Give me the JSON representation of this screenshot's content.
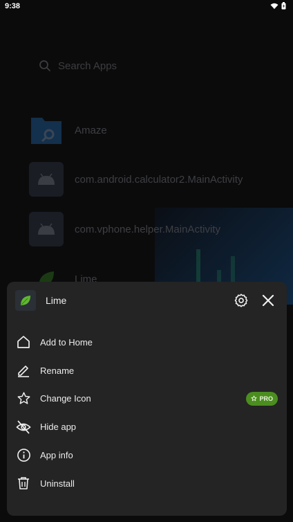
{
  "status_bar": {
    "time": "9:38"
  },
  "search": {
    "placeholder": "Search Apps"
  },
  "apps": [
    {
      "label": "Amaze",
      "icon": "folder-search-icon"
    },
    {
      "label": "com.android.calculator2.MainActivity",
      "icon": "android-icon"
    },
    {
      "label": "com.vphone.helper.MainActivity",
      "icon": "android-icon"
    },
    {
      "label": "Lime",
      "icon": "leaf-icon"
    }
  ],
  "sheet": {
    "app_name": "Lime",
    "items": [
      {
        "label": "Add to Home",
        "icon": "home-icon"
      },
      {
        "label": "Rename",
        "icon": "pencil-icon"
      },
      {
        "label": "Change Icon",
        "icon": "star-icon",
        "badge": "PRO"
      },
      {
        "label": "Hide app",
        "icon": "eye-off-icon"
      },
      {
        "label": "App info",
        "icon": "info-icon"
      },
      {
        "label": "Uninstall",
        "icon": "trash-icon"
      }
    ]
  },
  "colors": {
    "sheet_bg": "#242424",
    "pro_badge": "#4b8e1f",
    "accent_leaf": "#5fb731"
  }
}
